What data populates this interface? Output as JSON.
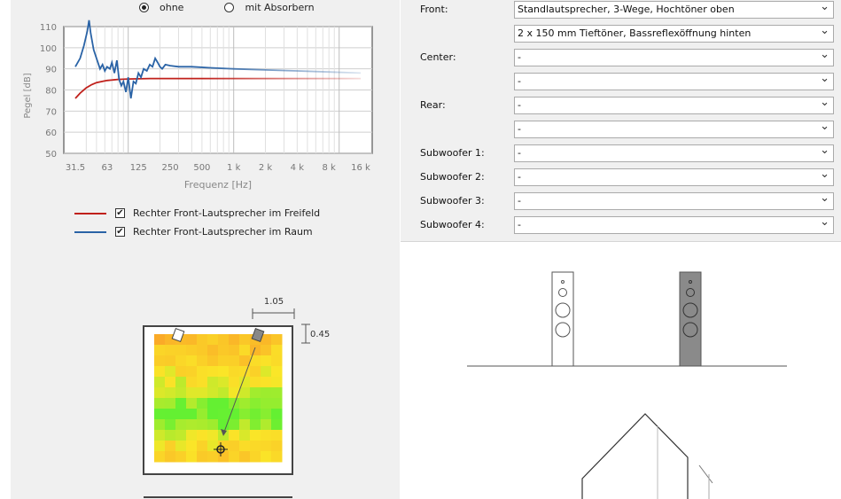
{
  "radio_options": [
    {
      "label": "ohne",
      "selected": true
    },
    {
      "label": "mit Absorbern",
      "selected": false
    }
  ],
  "chart_data": {
    "type": "line",
    "ylabel": "Pegel [dB]",
    "xlabel": "Frequenz [Hz]",
    "ylim": [
      50,
      110
    ],
    "y_ticks": [
      "110",
      "100",
      "90",
      "80",
      "70",
      "60",
      "50"
    ],
    "x_ticks": [
      "31.5",
      "63",
      "125",
      "250",
      "500",
      "1 k",
      "2 k",
      "4 k",
      "8 k",
      "16 k"
    ],
    "x_scale": "log",
    "grid": true,
    "series": [
      {
        "name": "Rechter Front-Lautsprecher im Freifeld",
        "color": "#c0201b",
        "x": [
          31.5,
          35,
          40,
          45,
          50,
          56,
          63,
          80,
          100,
          125,
          160,
          200,
          250,
          400,
          1000,
          4000,
          16000
        ],
        "y": [
          76,
          78.5,
          81,
          82.5,
          83.5,
          84,
          84.5,
          85,
          85.2,
          85.3,
          85.4,
          85.4,
          85.4,
          85.4,
          85.4,
          85.4,
          85.4
        ]
      },
      {
        "name": "Rechter Front-Lautsprecher im Raum",
        "color": "#2a63a6",
        "x": [
          31.5,
          35,
          38,
          41,
          42.5,
          44,
          47,
          50,
          54,
          57,
          60,
          63,
          67,
          70,
          74,
          78,
          82,
          86,
          90,
          95,
          100,
          106,
          112,
          118,
          125,
          132,
          140,
          150,
          160,
          170,
          180,
          190,
          200,
          210,
          225,
          250,
          300,
          400,
          600,
          1000,
          2000,
          4000,
          8000,
          16000
        ],
        "y": [
          91,
          95,
          101,
          108,
          113,
          107,
          99,
          95,
          90,
          92,
          89,
          91,
          90,
          93,
          88,
          94,
          85,
          82,
          84,
          79,
          86,
          76,
          84,
          83,
          88,
          86,
          90,
          89,
          92,
          91,
          95,
          93,
          91,
          90,
          92,
          91.5,
          91,
          91,
          90.5,
          90,
          89.5,
          89,
          88.5,
          88
        ]
      }
    ]
  },
  "legend": [
    {
      "label": "Rechter Front-Lautsprecher im Freifeld",
      "color": "#c0201b",
      "checked": true,
      "check_glyph": "✔"
    },
    {
      "label": "Rechter Front-Lautsprecher im Raum",
      "color": "#2a63a6",
      "checked": true,
      "check_glyph": "✔"
    }
  ],
  "room": {
    "dim_width": "1.05",
    "dim_depth": "0.45"
  },
  "config": [
    {
      "label": "Front:",
      "selects": [
        "Standlautsprecher, 3-Wege, Hochtöner oben",
        "2 x 150 mm Tieftöner, Bassreflexöffnung hinten"
      ]
    },
    {
      "label": "Center:",
      "selects": [
        "-",
        "-"
      ]
    },
    {
      "label": "Rear:",
      "selects": [
        "-",
        "-"
      ]
    },
    {
      "label": "Subwoofer 1:",
      "selects": [
        "-"
      ]
    },
    {
      "label": "Subwoofer 2:",
      "selects": [
        "-"
      ]
    },
    {
      "label": "Subwoofer 3:",
      "selects": [
        "-"
      ]
    },
    {
      "label": "Subwoofer 4:",
      "selects": [
        "-"
      ]
    }
  ],
  "icons": {
    "chevron": "chevron-down-icon"
  }
}
